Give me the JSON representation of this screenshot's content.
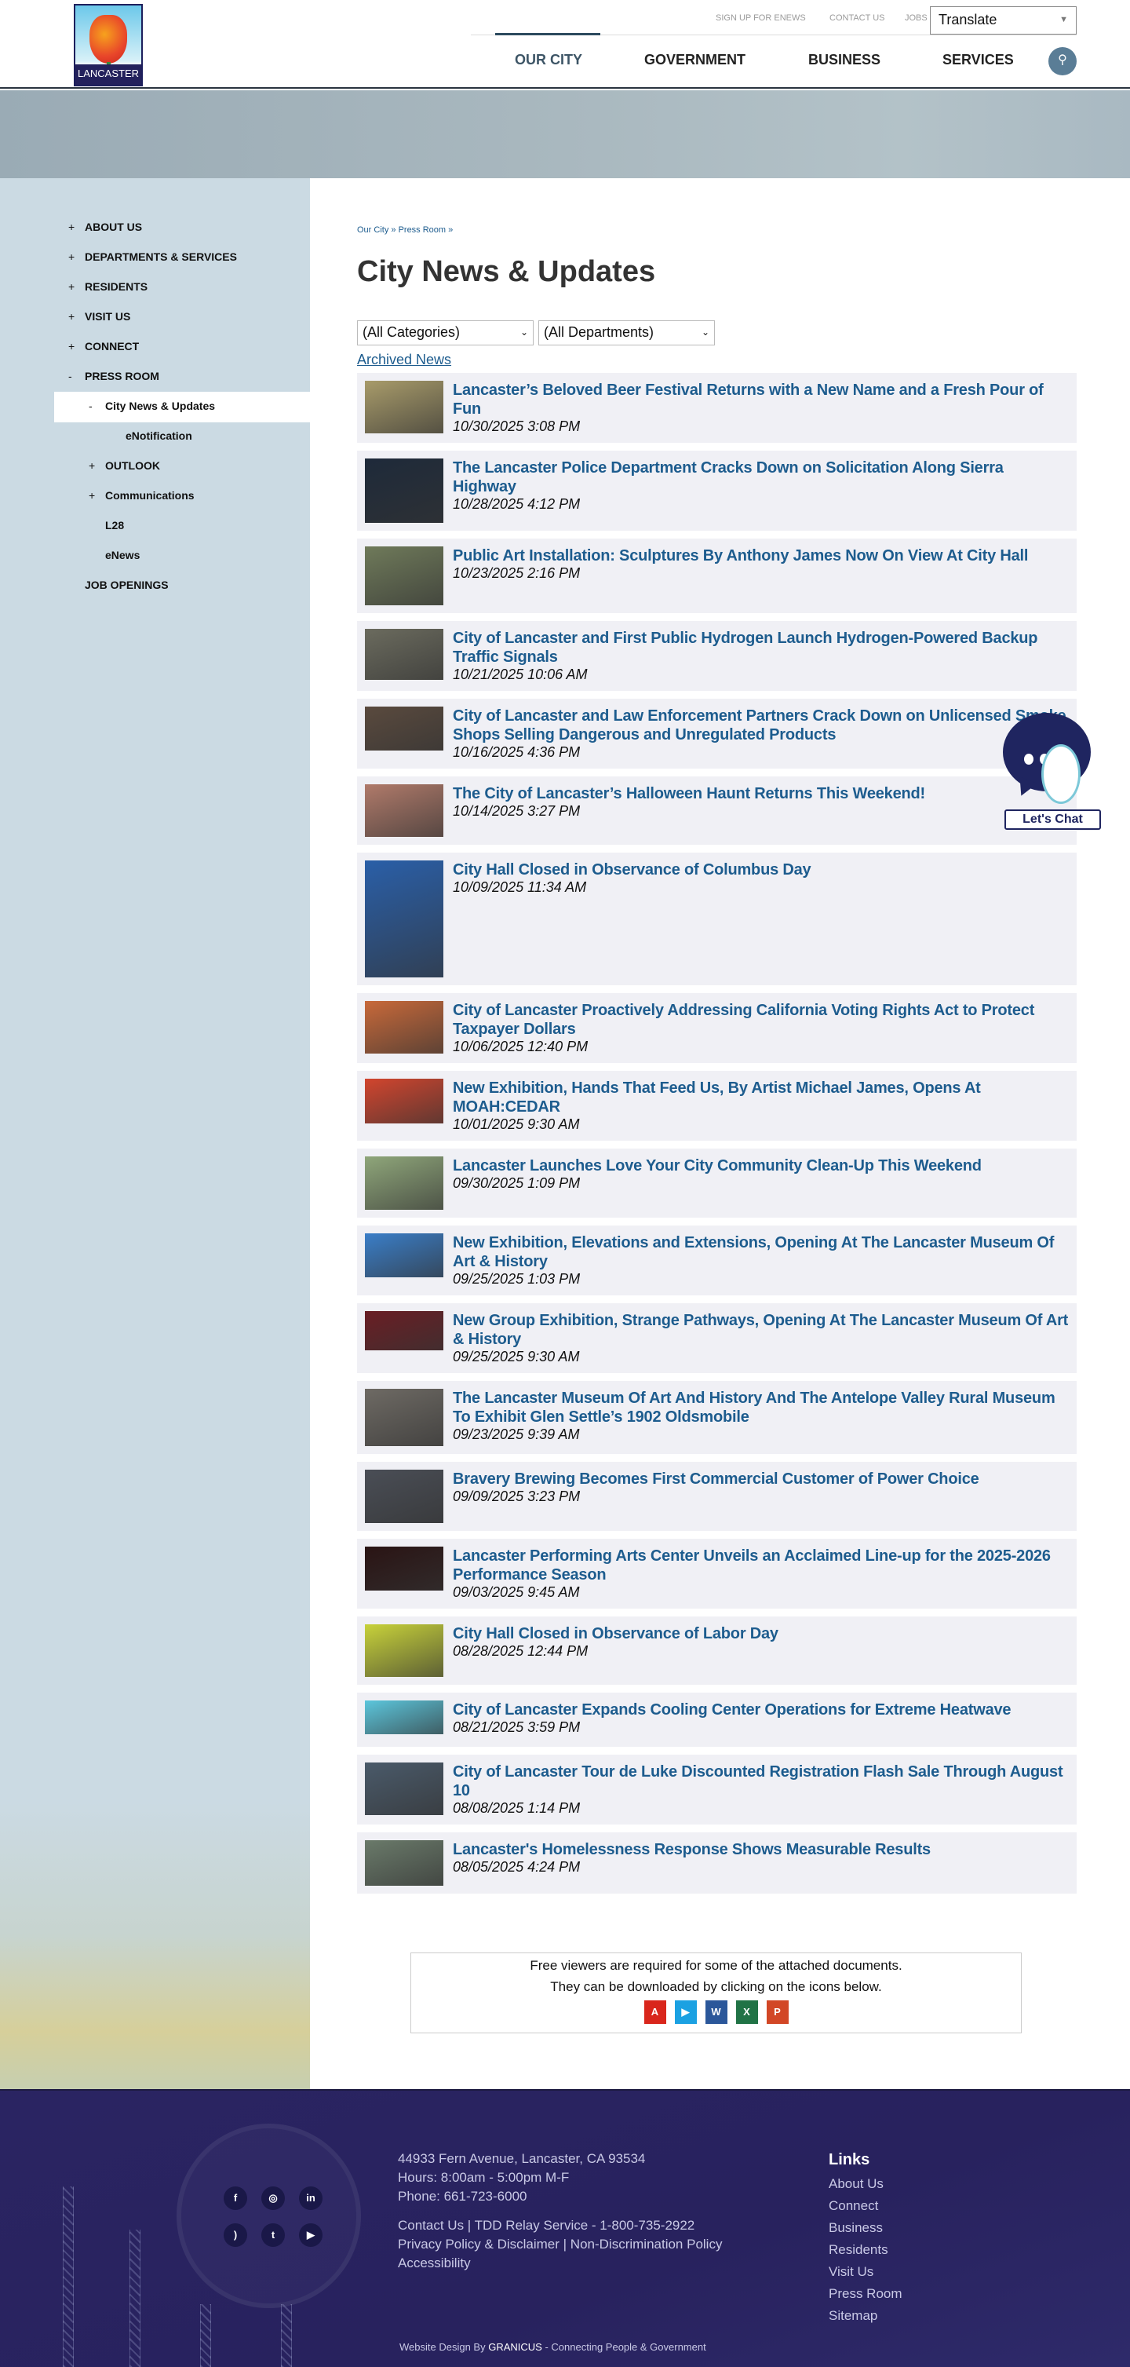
{
  "header": {
    "logo_text": "LANCASTER",
    "top_links": [
      "SIGN UP FOR ENEWS",
      "CONTACT US",
      "JOBS"
    ],
    "translate_label": "Translate",
    "nav": [
      "OUR CITY",
      "GOVERNMENT",
      "BUSINESS",
      "SERVICES"
    ],
    "active_nav": "OUR CITY",
    "search_icon": "search-icon"
  },
  "sidebar": {
    "items": [
      {
        "label": "ABOUT US",
        "marker": "+"
      },
      {
        "label": "DEPARTMENTS & SERVICES",
        "marker": "+"
      },
      {
        "label": "RESIDENTS",
        "marker": "+"
      },
      {
        "label": "VISIT US",
        "marker": "+"
      },
      {
        "label": "CONNECT",
        "marker": "+"
      },
      {
        "label": "PRESS ROOM",
        "marker": "-"
      },
      {
        "label": "City News & Updates",
        "marker": "-"
      },
      {
        "label": "eNotification",
        "marker": ""
      },
      {
        "label": "OUTLOOK",
        "marker": "+"
      },
      {
        "label": "Communications",
        "marker": "+"
      },
      {
        "label": "L28",
        "marker": ""
      },
      {
        "label": "eNews",
        "marker": ""
      },
      {
        "label": "JOB OPENINGS",
        "marker": ""
      }
    ]
  },
  "main": {
    "breadcrumb": "Our City » Press Room »",
    "title": "City News & Updates",
    "category_filter": "(All Categories)",
    "department_filter": "(All Departments)",
    "archived_link": "Archived News",
    "news": [
      {
        "title": "Lancaster’s Beloved Beer Festival Returns with a New Name and a Fresh Pour of Fun",
        "date": "10/30/2025 3:08 PM",
        "thumb_color": "#a89b6a"
      },
      {
        "title": "The Lancaster Police Department Cracks Down on Solicitation Along Sierra Highway",
        "date": "10/28/2025 4:12 PM",
        "thumb_color": "#1e2a3a"
      },
      {
        "title": "Public Art Installation: Sculptures By Anthony James Now On View At City Hall",
        "date": "10/23/2025 2:16 PM",
        "thumb_color": "#6f7a5a"
      },
      {
        "title": "City of Lancaster and First Public Hydrogen Launch Hydrogen-Powered Backup Traffic Signals",
        "date": "10/21/2025 10:06 AM",
        "thumb_color": "#6b6b5e"
      },
      {
        "title": "City of Lancaster and Law Enforcement Partners Crack Down on Unlicensed Smoke Shops Selling Dangerous and Unregulated Products",
        "date": "10/16/2025 4:36 PM",
        "thumb_color": "#5a4a3e"
      },
      {
        "title": "The City of Lancaster’s Halloween Haunt Returns This Weekend!",
        "date": "10/14/2025 3:27 PM",
        "thumb_color": "#b07a6a"
      },
      {
        "title": "City Hall Closed in Observance of Columbus Day",
        "date": "10/09/2025 11:34 AM",
        "thumb_color": "#2a5fa8"
      },
      {
        "title": "City of Lancaster Proactively Addressing California Voting Rights Act to Protect Taxpayer Dollars",
        "date": "10/06/2025 12:40 PM",
        "thumb_color": "#c8693a"
      },
      {
        "title": "New Exhibition, Hands That Feed Us, By Artist Michael James, Opens At MOAH:CEDAR",
        "date": "10/01/2025 9:30 AM",
        "thumb_color": "#d2452e"
      },
      {
        "title": "Lancaster Launches Love Your City Community Clean-Up This Weekend",
        "date": "09/30/2025 1:09 PM",
        "thumb_color": "#8fa67a"
      },
      {
        "title": "New Exhibition, Elevations and Extensions, Opening At The Lancaster Museum Of Art & History",
        "date": "09/25/2025 1:03 PM",
        "thumb_color": "#3a7ec8"
      },
      {
        "title": "New Group Exhibition, Strange Pathways, Opening At The Lancaster Museum Of Art & History",
        "date": "09/25/2025 9:30 AM",
        "thumb_color": "#6a1e24"
      },
      {
        "title": "The Lancaster Museum Of Art And History And The Antelope Valley Rural Museum To Exhibit Glen Settle’s 1902 Oldsmobile",
        "date": "09/23/2025 9:39 AM",
        "thumb_color": "#6e6a64"
      },
      {
        "title": "Bravery Brewing Becomes First Commercial Customer of Power Choice",
        "date": "09/09/2025 3:23 PM",
        "thumb_color": "#4a4e56"
      },
      {
        "title": "Lancaster Performing Arts Center Unveils an Acclaimed Line-up for the 2025-2026 Performance Season",
        "date": "09/03/2025 9:45 AM",
        "thumb_color": "#2a1414"
      },
      {
        "title": "City Hall Closed in Observance of Labor Day",
        "date": "08/28/2025 12:44 PM",
        "thumb_color": "#c8d23a"
      },
      {
        "title": "City of Lancaster Expands Cooling Center Operations for Extreme Heatwave",
        "date": "08/21/2025 3:59 PM",
        "thumb_color": "#5cc6dc"
      },
      {
        "title": "City of Lancaster Tour de Luke Discounted Registration Flash Sale Through August 10",
        "date": "08/08/2025 1:14 PM",
        "thumb_color": "#4a5a6a"
      },
      {
        "title": "Lancaster's Homelessness Response Shows Measurable Results",
        "date": "08/05/2025 4:24 PM",
        "thumb_color": "#6a7a6a"
      }
    ],
    "viewers": {
      "line1": "Free viewers are required for some of the attached documents.",
      "line2": "They can be downloaded by clicking on the icons below.",
      "icons": [
        {
          "name": "pdf-reader-icon",
          "glyph": "A",
          "color": "#d9261c"
        },
        {
          "name": "media-player-icon",
          "glyph": "▶",
          "color": "#1ba1e2"
        },
        {
          "name": "word-viewer-icon",
          "glyph": "W",
          "color": "#2b579a"
        },
        {
          "name": "excel-viewer-icon",
          "glyph": "X",
          "color": "#217346"
        },
        {
          "name": "powerpoint-viewer-icon",
          "glyph": "P",
          "color": "#d24726"
        }
      ]
    }
  },
  "chat": {
    "label": "Let's Chat"
  },
  "footer": {
    "address": "44933 Fern Avenue, Lancaster, CA 93534",
    "hours": "Hours: 8:00am - 5:00pm M-F",
    "phone": "Phone: 661-723-6000",
    "contact_line": "Contact Us | TDD Relay Service - 1-800-735-2922",
    "policy_line": "Privacy Policy & Disclaimer | Non-Discrimination Policy",
    "accessibility": "Accessibility",
    "links_heading": "Links",
    "links": [
      "About Us",
      "Connect",
      "Business",
      "Residents",
      "Visit Us",
      "Press Room",
      "Sitemap"
    ],
    "credit_prefix": "Website Design By",
    "credit_brand": "GRANICUS",
    "credit_suffix": "- Connecting People & Government",
    "social": [
      {
        "name": "facebook-icon",
        "glyph": "f"
      },
      {
        "name": "instagram-icon",
        "glyph": "◎"
      },
      {
        "name": "linkedin-icon",
        "glyph": "in"
      },
      {
        "name": "rss-icon",
        "glyph": ")"
      },
      {
        "name": "twitter-icon",
        "glyph": "t"
      },
      {
        "name": "youtube-icon",
        "glyph": "▶"
      }
    ]
  }
}
